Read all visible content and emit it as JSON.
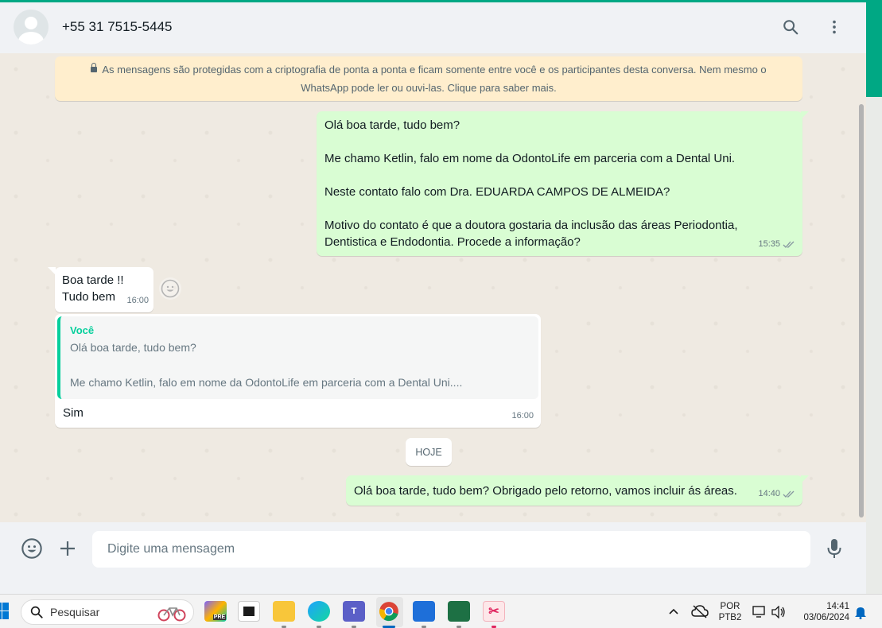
{
  "header": {
    "contact_name": "+55 31 7515-5445"
  },
  "chat": {
    "encryption_notice_line1": "As mensagens são protegidas com a criptografia de ponta a ponta e ficam somente entre você e os participantes desta conversa. Nem mesmo o",
    "encryption_notice_line2": "WhatsApp pode ler ou ouvi-las. Clique para saber mais.",
    "messages": [
      {
        "direction": "outgoing",
        "text": "Olá boa tarde, tudo bem?\n\nMe chamo Ketlin, falo em nome da OdontoLife em parceria com a Dental Uni.\n\nNeste contato falo com Dra. EDUARDA CAMPOS DE ALMEIDA?\n\nMotivo do contato é que a doutora gostaria da inclusão das áreas Periodontia,\nDentistica e Endodontia. Procede a informação?",
        "time": "15:35"
      },
      {
        "direction": "incoming",
        "text": "Boa tarde !!\nTudo bem",
        "time": "16:00"
      },
      {
        "direction": "incoming",
        "quote_author": "Você",
        "quote_text": "Olá boa tarde, tudo bem?\n\nMe chamo Ketlin, falo em nome da OdontoLife em parceria com a Dental Uni....",
        "text": "Sim",
        "time": "16:00"
      },
      {
        "direction": "outgoing",
        "text": "Olá boa tarde, tudo bem? Obrigado pelo retorno, vamos incluir ás áreas.",
        "time": "14:40"
      }
    ],
    "date_divider": "HOJE"
  },
  "composer": {
    "placeholder": "Digite uma mensagem"
  },
  "taskbar": {
    "search_label": "Pesquisar",
    "language_line1": "POR",
    "language_line2": "PTB2",
    "time": "14:41",
    "date": "03/06/2024",
    "copilot_badge": "PRE",
    "teams_letter": "T"
  },
  "colors": {
    "accent": "#00a884",
    "outgoing_bubble": "#d9fdd3",
    "incoming_bubble": "#ffffff",
    "chat_background": "#efeae2",
    "read_tick": "#667781"
  },
  "icons": {
    "header": [
      "search-icon",
      "menu-dots-icon"
    ],
    "footer": [
      "emoji-icon",
      "attach-plus-icon",
      "microphone-icon"
    ]
  }
}
